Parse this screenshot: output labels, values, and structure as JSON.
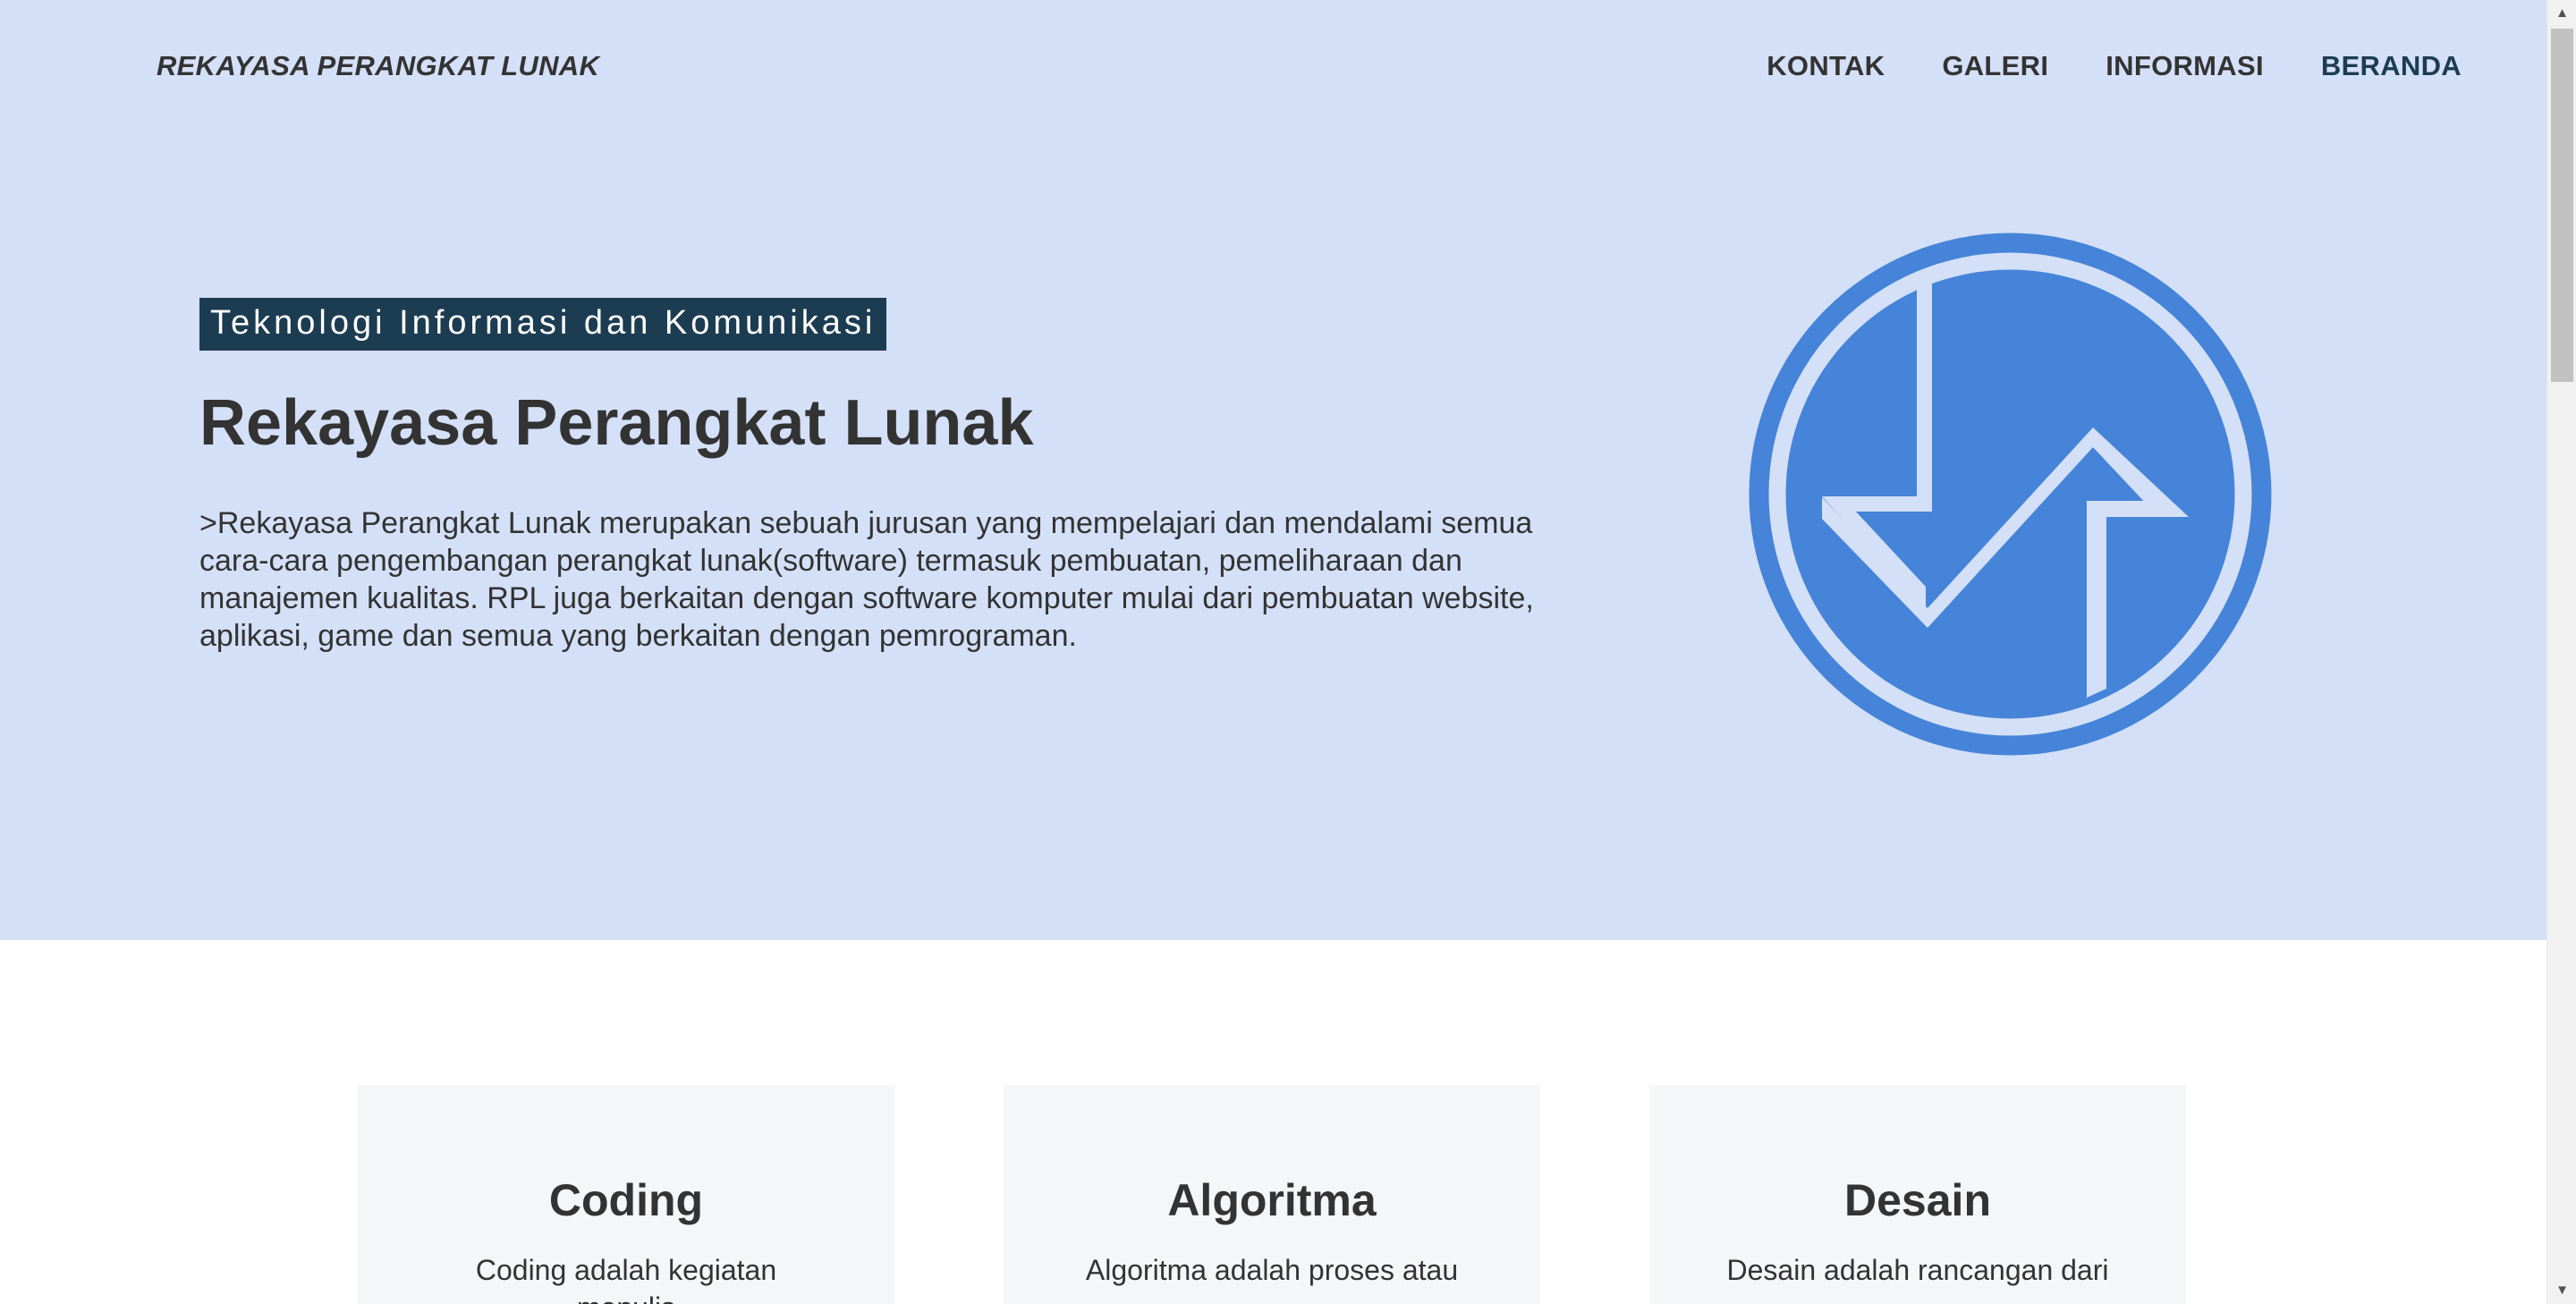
{
  "header": {
    "brand": "REKAYASA PERANGKAT LUNAK",
    "nav": [
      {
        "label": "KONTAK"
      },
      {
        "label": "GALERI"
      },
      {
        "label": "INFORMASI"
      },
      {
        "label": "BERANDA"
      }
    ]
  },
  "hero": {
    "tagline": "Teknologi Informasi dan Komunikasi",
    "title": "Rekayasa Perangkat Lunak",
    "description": ">Rekayasa Perangkat Lunak merupakan sebuah jurusan yang mempelajari dan mendalami semua cara-cara pengembangan perangkat lunak(software) termasuk pembuatan, pemeliharaan dan manajemen kualitas. RPL juga berkaitan dengan software komputer mulai dari pembuatan website, aplikasi, game dan semua yang berkaitan dengan pemrograman.",
    "logo_icon": "arrows-circle-logo-icon"
  },
  "cards": [
    {
      "title": "Coding",
      "text": "Coding adalah kegiatan menulis"
    },
    {
      "title": "Algoritma",
      "text": "Algoritma adalah proses atau"
    },
    {
      "title": "Desain",
      "text": "Desain adalah rancangan dari"
    }
  ],
  "colors": {
    "hero_background": "#d4e0f7",
    "tagline_background": "#1c3c52",
    "logo_blue": "#4584d8",
    "card_background": "#f5f6f8"
  }
}
